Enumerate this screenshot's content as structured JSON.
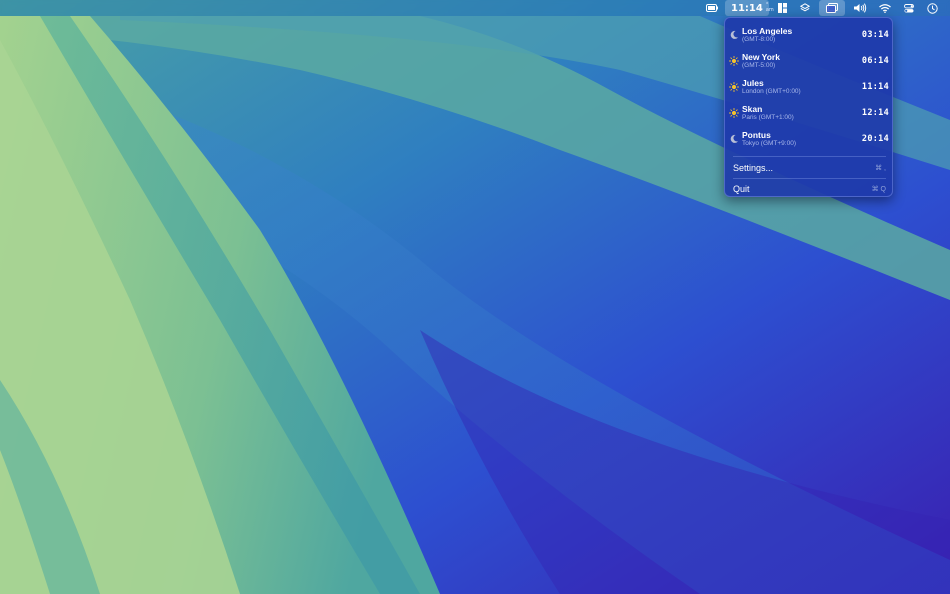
{
  "menubar": {
    "clock": {
      "time": "11:14",
      "extra_top": "°",
      "extra_bottom": "am"
    },
    "icons": [
      "battery-icon",
      "clock-item",
      "layout-icon",
      "layers-icon",
      "window-switcher-icon",
      "volume-icon",
      "wifi-icon",
      "control-center-icon",
      "timer-icon"
    ]
  },
  "dropdown": {
    "zones": [
      {
        "name": "Los Angeles",
        "detail": "(GMT-8:00)",
        "time": "03:14",
        "icon": "moon-icon"
      },
      {
        "name": "New York",
        "detail": "(GMT-5:00)",
        "time": "06:14",
        "icon": "sun-icon"
      },
      {
        "name": "Jules",
        "detail": "London (GMT+0:00)",
        "time": "11:14",
        "icon": "sun-icon"
      },
      {
        "name": "Skan",
        "detail": "Paris (GMT+1:00)",
        "time": "12:14",
        "icon": "sun-icon"
      },
      {
        "name": "Pontus",
        "detail": "Tokyo (GMT+9:00)",
        "time": "20:14",
        "icon": "moon-icon"
      }
    ],
    "settings": {
      "label": "Settings...",
      "shortcut": "⌘ ,"
    },
    "quit": {
      "label": "Quit",
      "shortcut": "⌘ Q"
    }
  },
  "colors": {
    "dropdown_bg": "#1e3aaa",
    "wallpaper_green": "#9ccf8e",
    "wallpaper_teal": "#5fae98",
    "wallpaper_blue": "#2a56c8",
    "wallpaper_indigo": "#3a1fb0"
  }
}
